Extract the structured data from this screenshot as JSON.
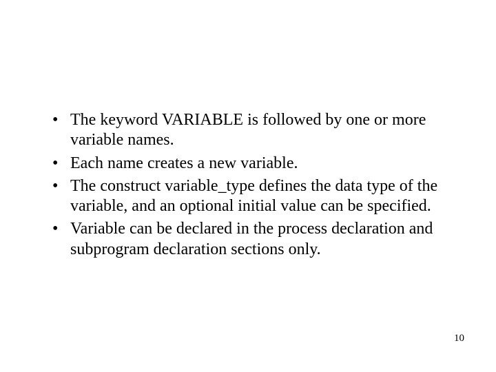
{
  "bullets": [
    "The keyword VARIABLE is followed  by one or more variable  names.",
    "Each name creates a new variable.",
    "The construct variable_type defines the data type of the variable, and an optional initial  value can be specified.",
    "Variable can be declared in the process declaration and subprogram declaration sections only."
  ],
  "page_number": "10"
}
